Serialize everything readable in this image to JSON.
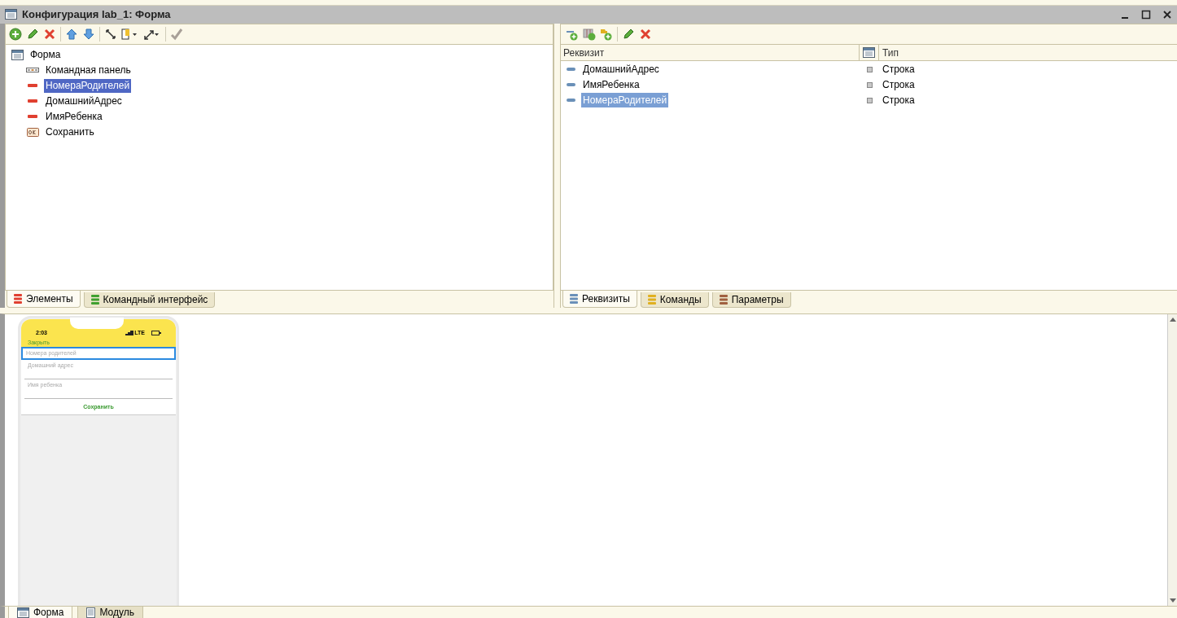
{
  "window": {
    "title": "Конфигурация lab_1: Форма"
  },
  "elements_panel": {
    "tree": {
      "label": "Форма",
      "children": [
        {
          "label": "Командная панель",
          "kind": "command_bar",
          "selected": false
        },
        {
          "label": "НомераРодителей",
          "kind": "field",
          "selected": true
        },
        {
          "label": "ДомашнийАдрес",
          "kind": "field",
          "selected": false
        },
        {
          "label": "ИмяРебенка",
          "kind": "field",
          "selected": false
        },
        {
          "label": "Сохранить",
          "kind": "button",
          "selected": false
        }
      ]
    },
    "tabs": [
      {
        "label": "Элементы",
        "selected": true,
        "color": "#e04030"
      },
      {
        "label": "Командный интерфейс",
        "selected": false,
        "color": "#40a030"
      }
    ]
  },
  "attributes_panel": {
    "columns": [
      "Реквизит",
      "Тип"
    ],
    "rows": [
      {
        "name": "ДомашнийАдрес",
        "type": "Строка",
        "selected": false
      },
      {
        "name": "ИмяРебенка",
        "type": "Строка",
        "selected": false
      },
      {
        "name": "НомераРодителей",
        "type": "Строка",
        "selected": true
      }
    ],
    "tabs": [
      {
        "label": "Реквизиты",
        "selected": true,
        "color": "#6a90b8"
      },
      {
        "label": "Команды",
        "selected": false,
        "color": "#e0b020"
      },
      {
        "label": "Параметры",
        "selected": false,
        "color": "#a06040"
      }
    ]
  },
  "preview": {
    "time": "2:03",
    "network": "LTE",
    "close_link": "Закрыть",
    "fields": [
      {
        "label": "Номера родителей",
        "focused": true
      },
      {
        "label": "Домашний адрес",
        "focused": false
      },
      {
        "label": "Имя ребенка",
        "focused": false
      }
    ],
    "button": "Сохранить"
  },
  "bottom_tabs": [
    {
      "label": "Форма",
      "selected": true
    },
    {
      "label": "Модуль",
      "selected": false
    }
  ]
}
